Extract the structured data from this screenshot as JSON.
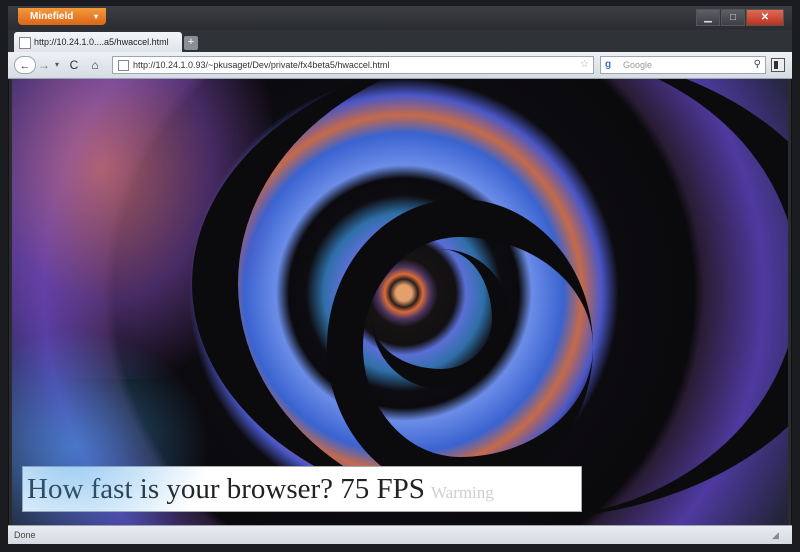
{
  "app": {
    "name": "Minefield"
  },
  "window": {
    "minimize_glyph": "▁",
    "maximize_glyph": "□",
    "close_glyph": "✕"
  },
  "tab": {
    "title": "http://10.24.1.0....a5/hwaccel.html",
    "new_tab_glyph": "+"
  },
  "nav": {
    "back_glyph": "←",
    "forward_glyph": "→",
    "dropdown_glyph": "▾",
    "reload_glyph": "C",
    "home_glyph": "⌂",
    "url": "http://10.24.1.0.93/~pkusaget/Dev/private/fx4beta5/hwaccel.html",
    "star_glyph": "☆",
    "search_placeholder": "Google",
    "search_engine_glyph": "g",
    "search_glyph": "⚲"
  },
  "page": {
    "caption_prefix": "How fast is your browser?",
    "fps": "75 FPS",
    "status_word": "Warming"
  },
  "statusbar": {
    "text": "Done",
    "grip_glyph": "◢"
  },
  "colors": {
    "accent": "#e8761f",
    "close": "#c83c28"
  },
  "icons": [
    "favicon-icon",
    "back-arrow-icon",
    "forward-arrow-icon",
    "reload-icon",
    "home-icon",
    "bookmark-star-icon",
    "google-icon",
    "search-icon",
    "sidebar-icon"
  ]
}
